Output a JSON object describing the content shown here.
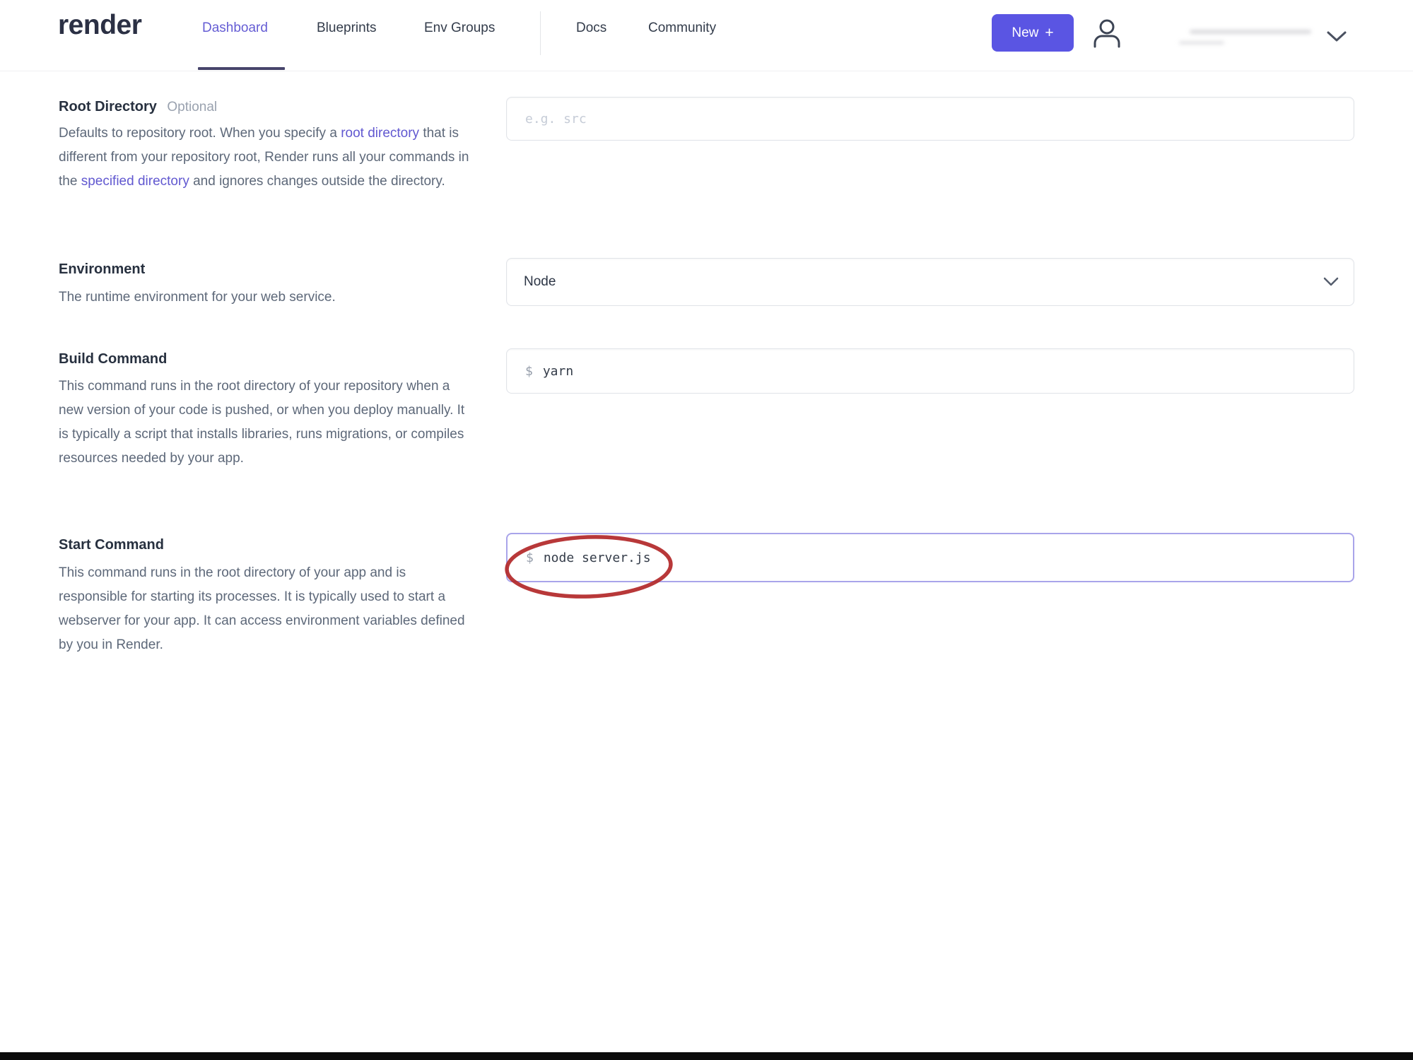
{
  "header": {
    "logo": "render",
    "nav": [
      {
        "label": "Dashboard",
        "active": true
      },
      {
        "label": "Blueprints",
        "active": false
      },
      {
        "label": "Env Groups",
        "active": false
      },
      {
        "label": "Docs",
        "active": false
      },
      {
        "label": "Community",
        "active": false
      }
    ],
    "new_button": {
      "label": "New",
      "plus_icon": "+"
    },
    "user_icon": "user-icon",
    "chevron_icon": "chevron-down-icon"
  },
  "form": {
    "root_directory": {
      "label": "Root Directory",
      "optional_badge": "Optional",
      "desc_part1": "Defaults to repository root. When you specify a ",
      "link1": "root directory",
      "desc_part2": " that is different from your repository root, Render runs all your commands in the ",
      "link2": "specified directory",
      "desc_part3": " and ignores changes outside the directory.",
      "placeholder": "e.g. src",
      "value": ""
    },
    "environment": {
      "label": "Environment",
      "description": "The runtime environment for your web service.",
      "value": "Node",
      "chevron_icon": "chevron-down-icon"
    },
    "build_command": {
      "label": "Build Command",
      "description": "This command runs in the root directory of your repository when a new version of your code is pushed, or when you deploy manually. It is typically a script that installs libraries, runs migrations, or compiles resources needed by your app.",
      "prompt": "$",
      "value": "yarn"
    },
    "start_command": {
      "label": "Start Command",
      "description": "This command runs in the root directory of your app and is responsible for starting its processes. It is typically used to start a webserver for your app. It can access environment variables defined by you in Render.",
      "prompt": "$",
      "value": "node server.js",
      "annotation": "red-ellipse-highlight"
    }
  },
  "colors": {
    "accent": "#5a55e3",
    "active_nav": "#655dd4",
    "link": "#6158d0",
    "annotation_red": "#b3292a",
    "heading_text": "#27303f",
    "body_text": "#5d6879"
  }
}
